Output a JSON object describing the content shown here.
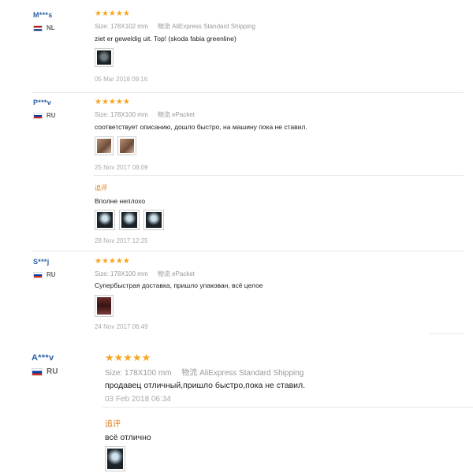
{
  "reviews": [
    {
      "user": "M***s",
      "country": "NL",
      "stars": "★★★★★",
      "size_label": "Size:",
      "size": "178X102 mm",
      "ship_label": "物流",
      "shipping": "AliExpress Standard Shipping",
      "text": "ziet er geweldig uit. Top! (skoda fabia greenline)",
      "date": "05 Mar 2018 09:16"
    },
    {
      "user": "P***v",
      "country": "RU",
      "stars": "★★★★★",
      "size_label": "Size:",
      "size": "178X100 mm",
      "ship_label": "物流",
      "shipping": "ePacket",
      "text": "соответствует описанию, дошло быстро, на машину пока не ставил.",
      "date": "25 Nov 2017 08:09",
      "additional_label": "追评",
      "additional_text": "Вполне неплохо",
      "additional_date": "28 Nov 2017 12:25"
    },
    {
      "user": "S***j",
      "country": "RU",
      "stars": "★★★★★",
      "size_label": "Size:",
      "size": "178X100 mm",
      "ship_label": "物流",
      "shipping": "ePacket",
      "text": "Супербыстрая доставка, пришло упакован, всё целое",
      "date": "24 Nov 2017 06:49"
    },
    {
      "user": "A***v",
      "country": "RU",
      "stars": "★★★★★",
      "size_label": "Size:",
      "size": "178X100 mm",
      "ship_label": "物流",
      "shipping": "AliExpress Standard Shipping",
      "text": "продавец отличный,пришло быстро,пока не ставил.",
      "date": "03 Feb 2018 06:34",
      "additional_label": "追评",
      "additional_text": "всё отлично"
    }
  ]
}
